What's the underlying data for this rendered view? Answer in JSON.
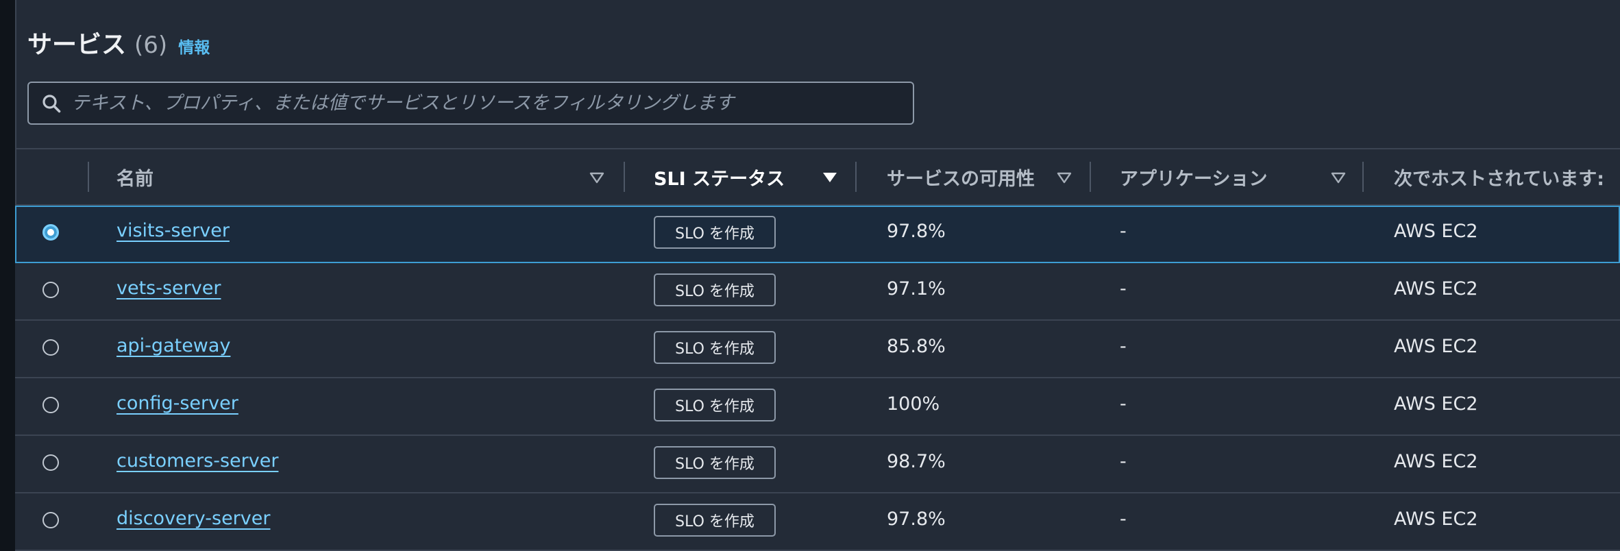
{
  "services_panel": {
    "title": "サービス",
    "count": "(6)",
    "info_link": "情報"
  },
  "search": {
    "placeholder": "テキスト、プロパティ、または値でサービスとリソースをフィルタリングします"
  },
  "table": {
    "columns": [
      {
        "label": "名前",
        "sorted": false
      },
      {
        "label": "SLI ステータス",
        "sorted": true
      },
      {
        "label": "サービスの可用性",
        "sorted": false
      },
      {
        "label": "アプリケーション",
        "sorted": false
      },
      {
        "label": "次でホストされています:",
        "sorted": false
      }
    ],
    "rows": [
      {
        "name": "visits-server",
        "slo_button": "SLO を作成",
        "availability": "97.8%",
        "application": "-",
        "hosted_on": "AWS EC2",
        "selected": true
      },
      {
        "name": "vets-server",
        "slo_button": "SLO を作成",
        "availability": "97.1%",
        "application": "-",
        "hosted_on": "AWS EC2",
        "selected": false
      },
      {
        "name": "api-gateway",
        "slo_button": "SLO を作成",
        "availability": "85.8%",
        "application": "-",
        "hosted_on": "AWS EC2",
        "selected": false
      },
      {
        "name": "config-server",
        "slo_button": "SLO を作成",
        "availability": "100%",
        "application": "-",
        "hosted_on": "AWS EC2",
        "selected": false
      },
      {
        "name": "customers-server",
        "slo_button": "SLO を作成",
        "availability": "98.7%",
        "application": "-",
        "hosted_on": "AWS EC2",
        "selected": false
      },
      {
        "name": "discovery-server",
        "slo_button": "SLO を作成",
        "availability": "97.8%",
        "application": "-",
        "hosted_on": "AWS EC2",
        "selected": false
      }
    ]
  },
  "icons": {
    "search": "search-icon",
    "sort": "sort-caret-icon"
  },
  "colors": {
    "link": "#7ad0ff",
    "accent": "#3d9dd3",
    "panel_bg": "#232b37"
  }
}
